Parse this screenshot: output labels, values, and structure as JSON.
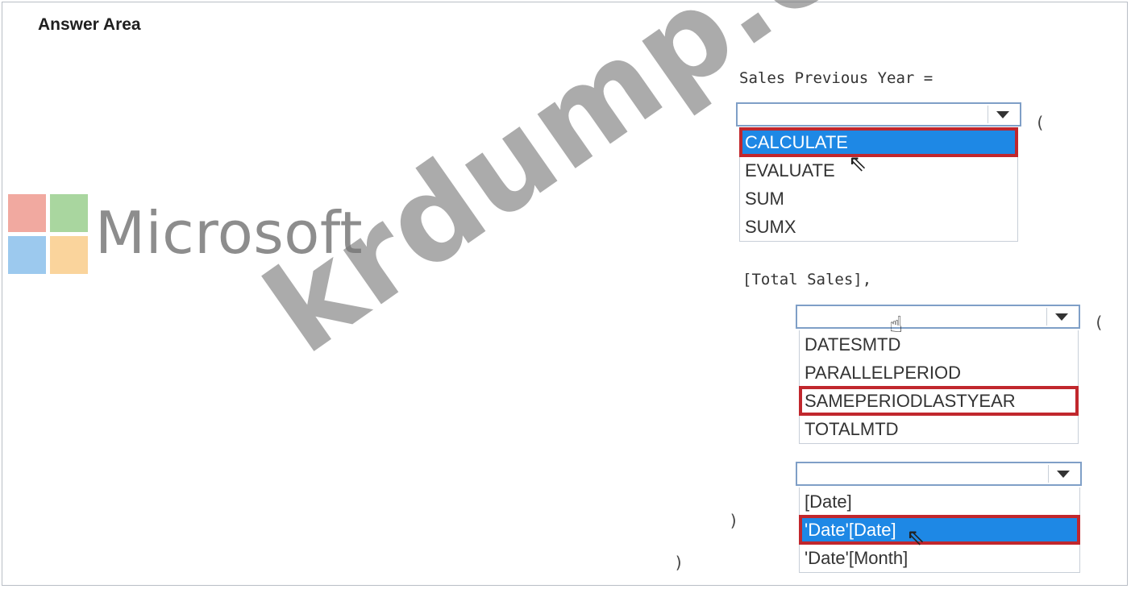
{
  "answer_area": {
    "title": "Answer Area"
  },
  "brand": {
    "name": "Microsoft",
    "colors": [
      "#f1a9a0",
      "#a9d69f",
      "#9cc9ee",
      "#fad49c"
    ]
  },
  "code": {
    "line1": "Sales Previous Year =",
    "open_paren_1": "(",
    "line2": "[Total Sales],",
    "open_paren_2": "(",
    "close_paren_inner": ")",
    "close_paren_outer": ")"
  },
  "dropdown1": {
    "items": [
      "CALCULATE",
      "EVALUATE",
      "SUM",
      "SUMX"
    ],
    "selected": "CALCULATE"
  },
  "dropdown2": {
    "items": [
      "DATESMTD",
      "PARALLELPERIOD",
      "SAMEPERIODLASTYEAR",
      "TOTALMTD"
    ],
    "selected": "SAMEPERIODLASTYEAR"
  },
  "dropdown3": {
    "items": [
      "[Date]",
      "'Date'[Date]",
      "'Date'[Month]"
    ],
    "selected": "'Date'[Date]"
  },
  "watermark": {
    "text": "krdump.com"
  },
  "colors": {
    "highlight": "#1e88e5",
    "answer_border": "#c1272d"
  }
}
